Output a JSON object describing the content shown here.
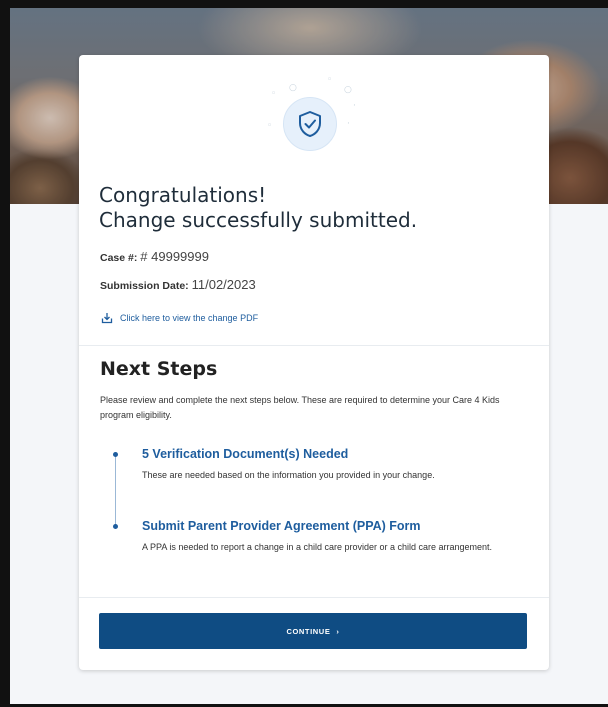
{
  "colors": {
    "primary": "#0f4c83",
    "link": "#1e5d9e",
    "badge_bg": "#e6f0fb"
  },
  "icons": {
    "badge": "shield-check-icon",
    "pdf": "download-icon",
    "continue": "chevron-right-icon"
  },
  "confirmation": {
    "title_line1": "Congratulations!",
    "title_line2": "Change successfully submitted.",
    "case_label": "Case #:",
    "case_value": "# 49999999",
    "date_label": "Submission Date:",
    "date_value": "11/02/2023",
    "pdf_link": "Click here to view the change PDF"
  },
  "next_steps": {
    "title": "Next Steps",
    "description": "Please review and complete the next steps below. These are required to determine your Care 4 Kids program eligibility.",
    "items": [
      {
        "title": "5 Verification Document(s) Needed",
        "body": "These are needed based on the information you provided in your change."
      },
      {
        "title": "Submit Parent Provider Agreement (PPA) Form",
        "body": "A PPA is needed to report a change in a child care provider or a child care arrangement."
      }
    ]
  },
  "actions": {
    "continue_label": "CONTINUE",
    "continue_arrow": "›"
  }
}
